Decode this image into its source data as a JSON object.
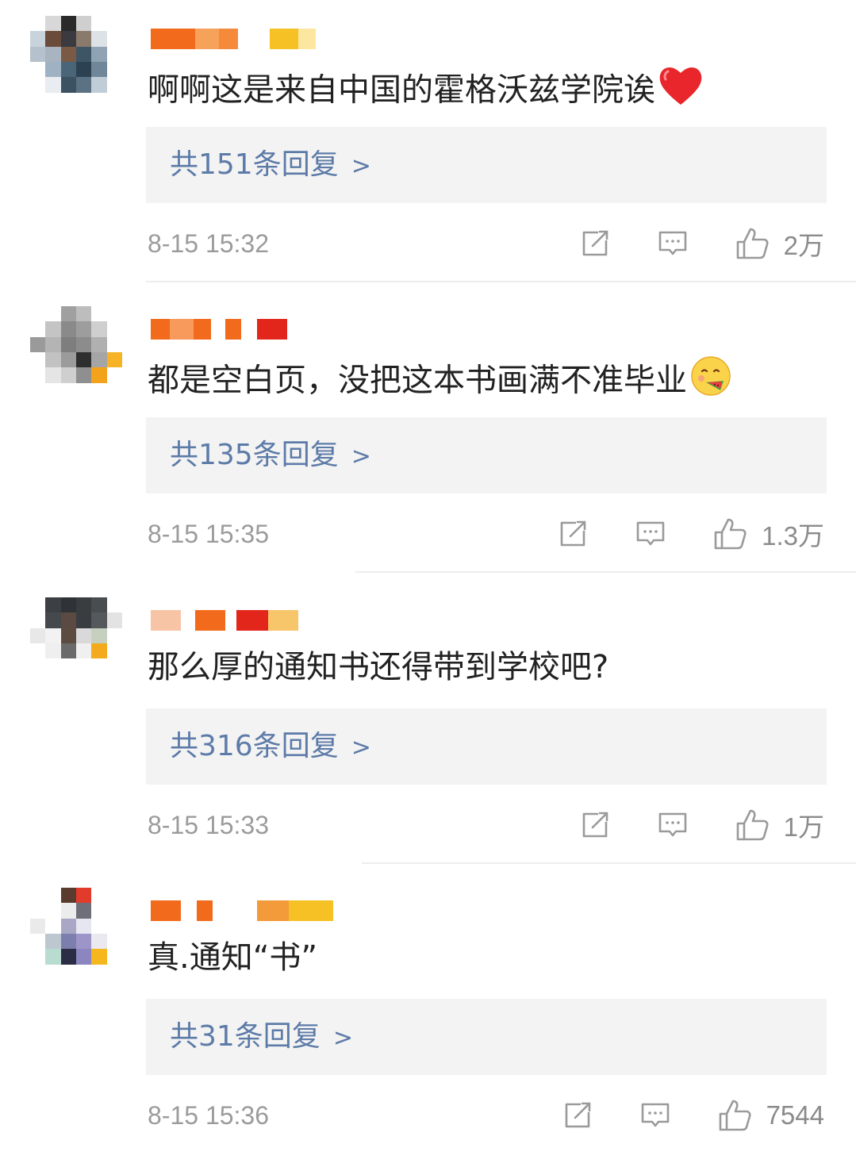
{
  "comments": [
    {
      "text": "啊啊这是来自中国的霍格沃兹学院诶",
      "emoji": "red-heart",
      "replies": "共151条回复",
      "time": "8-15 15:32",
      "likes": "2万"
    },
    {
      "text": "都是空白页，没把这本书画满不准毕业",
      "emoji": "face-eating-watermelon",
      "replies": "共135条回复",
      "time": "8-15 15:35",
      "likes": "1.3万"
    },
    {
      "text": "那么厚的通知书还得带到学校吧?",
      "emoji": "",
      "replies": "共316条回复",
      "time": "8-15 15:33",
      "likes": "1万"
    },
    {
      "text": "真.通知“书”",
      "emoji": "",
      "replies": "共31条回复",
      "time": "8-15 15:36",
      "likes": "7544"
    }
  ],
  "reply_chevron": ">",
  "colors": {
    "reply_link": "#5d7ba8",
    "reply_box_bg": "#f3f3f3",
    "text": "#222222",
    "meta": "#9b9b9b",
    "username_orange": "#f26a1b"
  },
  "icons": [
    "share-icon",
    "comment-icon",
    "thumbs-up-icon"
  ]
}
